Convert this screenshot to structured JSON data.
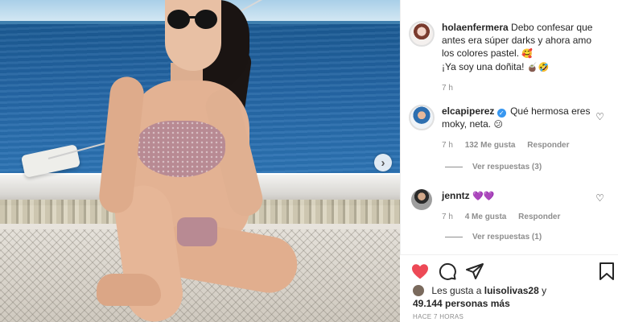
{
  "post": {
    "caption": {
      "username": "holaenfermera",
      "text_line1": "Debo confesar que antes era súper darks y ahora amo los colores pastel.",
      "emoji1": "🥰",
      "text_line2": "¡Ya soy una doñita!",
      "emoji2": "🧉🤣",
      "time": "7 h"
    },
    "comments": [
      {
        "username": "elcapiperez",
        "verified": true,
        "text": "Qué hermosa eres moky, neta.",
        "emoji": "😕",
        "time": "7 h",
        "likes": "132 Me gusta",
        "reply_label": "Responder",
        "view_replies": "Ver respuestas (3)"
      },
      {
        "username": "jenntz",
        "text": "💜💜",
        "time": "7 h",
        "likes": "4 Me gusta",
        "reply_label": "Responder",
        "view_replies": "Ver respuestas (1)"
      }
    ],
    "likes_summary": {
      "prefix": "Les gusta a",
      "user": "luisolivas28",
      "joiner": "y",
      "count": "49.144 personas más"
    },
    "time_ago": "HACE 7 HORAS"
  },
  "icons": {
    "like": "heart-icon",
    "comment": "comment-icon",
    "share": "share-icon",
    "save": "bookmark-icon",
    "next": "chevron-right-icon"
  },
  "colors": {
    "like_red": "#ed4956",
    "verified_blue": "#3897f0",
    "muted_text": "#8e8e8e"
  }
}
